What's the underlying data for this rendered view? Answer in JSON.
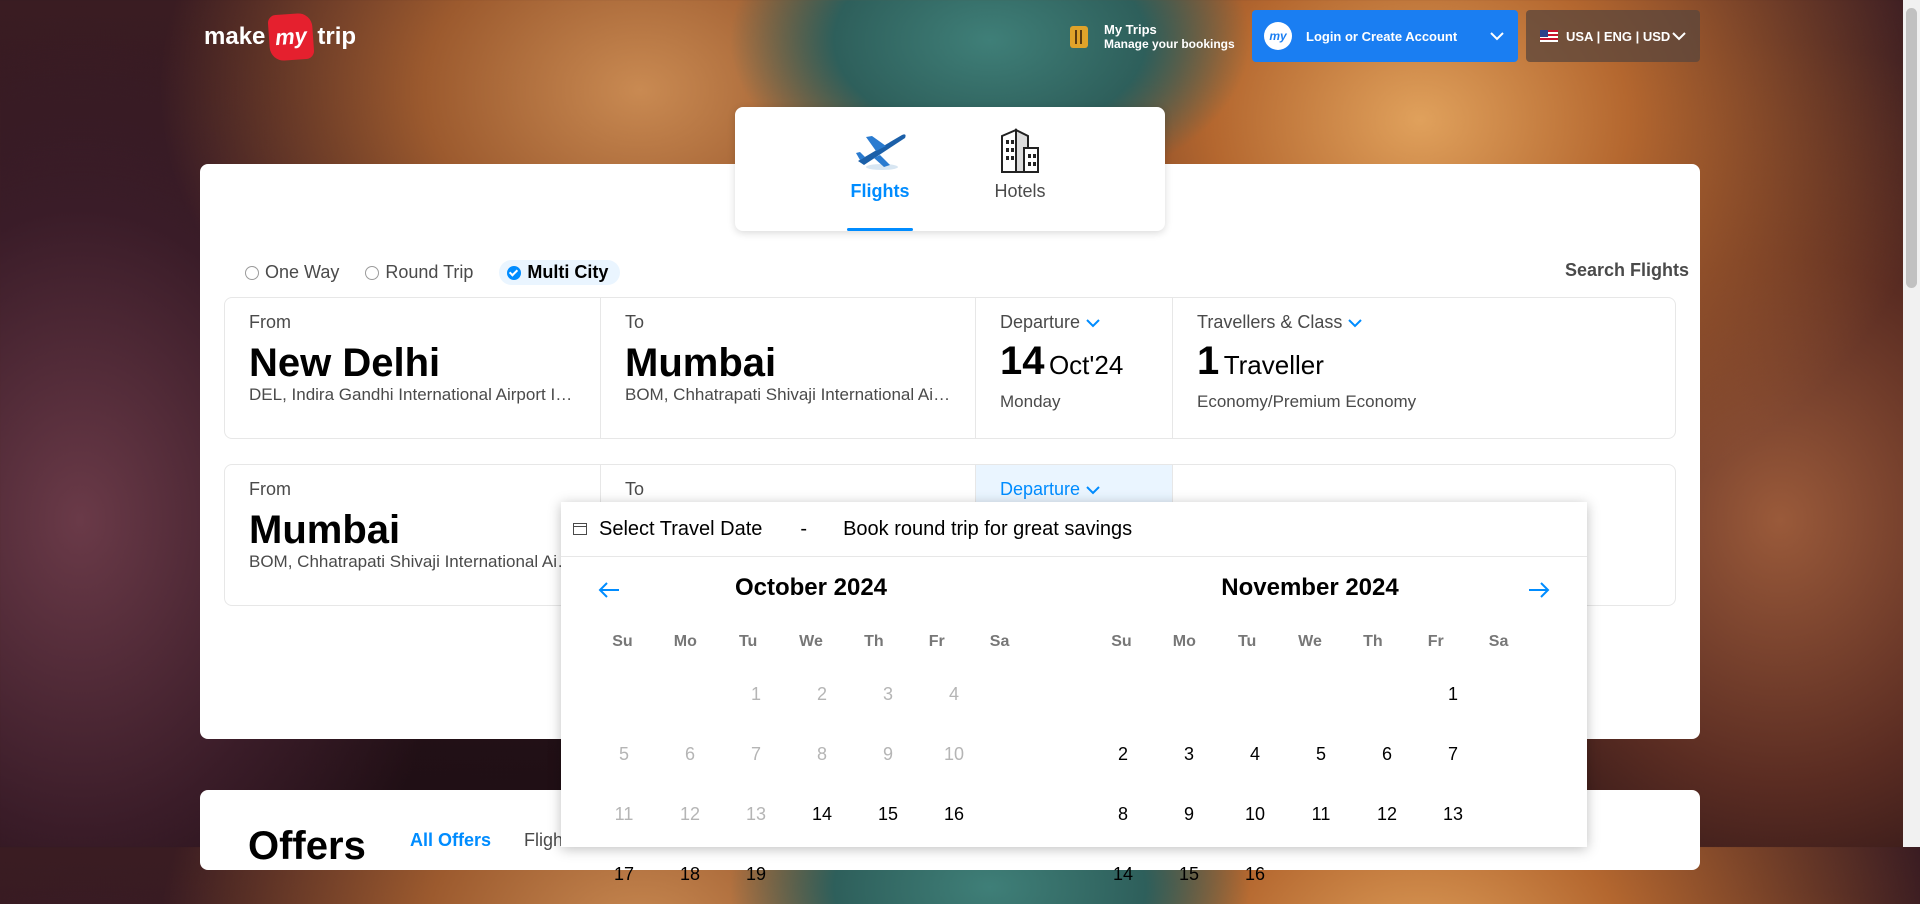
{
  "header": {
    "logo": {
      "make": "make",
      "my": "my",
      "trip": "trip"
    },
    "my_trips": {
      "title": "My Trips",
      "subtitle": "Manage your bookings"
    },
    "login_label": "Login or Create Account",
    "login_badge": "my",
    "locale_label": "USA | ENG | USD"
  },
  "tabs": [
    {
      "label": "Flights",
      "active": true,
      "icon": "airplane-icon"
    },
    {
      "label": "Hotels",
      "active": false,
      "icon": "hotel-icon"
    }
  ],
  "trip_types": [
    {
      "label": "One Way",
      "selected": false
    },
    {
      "label": "Round Trip",
      "selected": false
    },
    {
      "label": "Multi City",
      "selected": true
    }
  ],
  "search_label": "Search Flights",
  "leg1": {
    "from": {
      "label": "From",
      "city": "New Delhi",
      "airport": "DEL, Indira Gandhi International Airport India"
    },
    "to": {
      "label": "To",
      "city": "Mumbai",
      "airport": "BOM, Chhatrapati Shivaji International Airport India"
    },
    "departure": {
      "label": "Departure",
      "day": "14",
      "month": "Oct'24",
      "weekday": "Monday"
    },
    "travellers": {
      "label": "Travellers & Class",
      "count": "1",
      "unit": "Traveller",
      "class": "Economy/Premium Economy"
    }
  },
  "leg2": {
    "from": {
      "label": "From",
      "city": "Mumbai",
      "airport": "BOM, Chhatrapati Shivaji International Airport India"
    },
    "to": {
      "label": "To"
    },
    "departure": {
      "label": "Departure"
    }
  },
  "calendar": {
    "header_title": "Select Travel Date",
    "header_sep": "-",
    "header_promo": "Book round trip for great savings",
    "weekdays": [
      "Su",
      "Mo",
      "Tu",
      "We",
      "Th",
      "Fr",
      "Sa"
    ],
    "months": [
      {
        "name": "October 2024",
        "lead_blanks": 2,
        "days": [
          "1",
          "2",
          "3",
          "4",
          "5",
          "6",
          "7",
          "8",
          "9",
          "10",
          "11",
          "12",
          "13",
          "14",
          "15",
          "16",
          "17",
          "18",
          "19"
        ],
        "disabled_through": 13
      },
      {
        "name": "November 2024",
        "lead_blanks": 5,
        "days": [
          "1",
          "2",
          "3",
          "4",
          "5",
          "6",
          "7",
          "8",
          "9",
          "10",
          "11",
          "12",
          "13",
          "14",
          "15",
          "16"
        ],
        "disabled_through": 0
      }
    ]
  },
  "offers": {
    "title": "Offers",
    "tab_all": "All Offers",
    "tab_flights": "Fligh"
  },
  "colors": {
    "accent": "#008cff",
    "brand_red": "#e5202e",
    "login_bg": "#1a7ef2"
  }
}
